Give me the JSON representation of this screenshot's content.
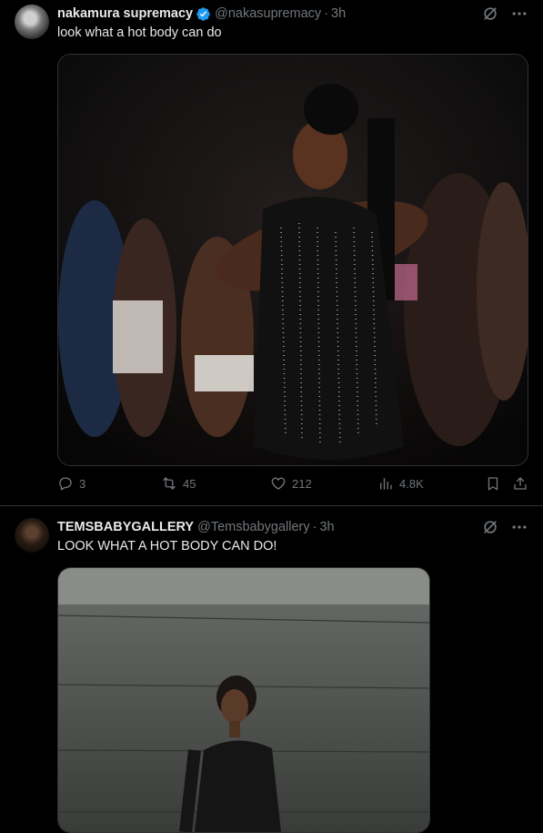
{
  "tweets": [
    {
      "display_name": "nakamura supremacy",
      "verified": true,
      "handle": "@nakasupremacy",
      "separator": "·",
      "time": "3h",
      "text": "look what a hot body can do",
      "actions": {
        "replies": "3",
        "retweets": "45",
        "likes": "212",
        "views": "4.8K"
      }
    },
    {
      "display_name": "TEMSBABYGALLERY",
      "handle": "@Temsbabygallery",
      "separator": "·",
      "time": "3h",
      "text": "LOOK WHAT A HOT BODY CAN DO!"
    }
  ],
  "icons": {
    "verified": "verified-badge-icon",
    "grok": "grok-icon",
    "more": "more-options-icon",
    "reply": "reply-icon",
    "retweet": "retweet-icon",
    "like": "heart-icon",
    "views": "views-icon",
    "bookmark": "bookmark-icon",
    "share": "share-icon"
  },
  "colors": {
    "background": "#000000",
    "text": "#e7e9ea",
    "muted": "#71767b",
    "verified": "#1d9bf0",
    "divider": "#2f3336"
  }
}
